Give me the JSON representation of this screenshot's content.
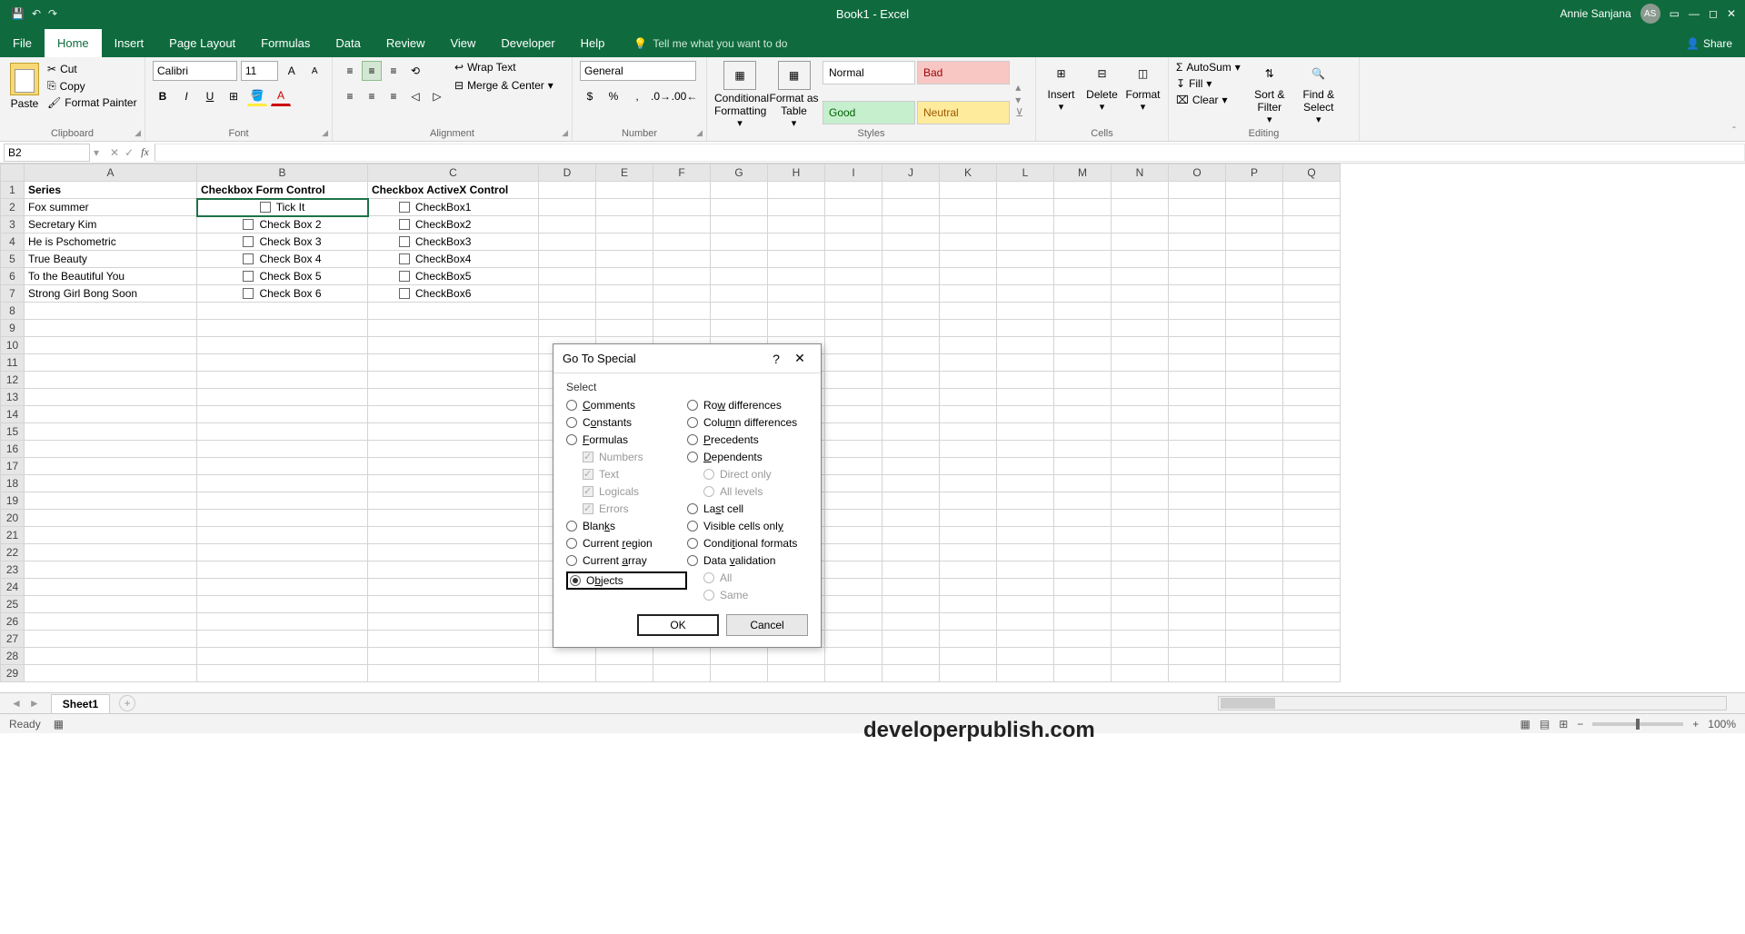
{
  "titlebar": {
    "title": "Book1 - Excel",
    "user": "Annie Sanjana",
    "initials": "AS"
  },
  "tabs": [
    "File",
    "Home",
    "Insert",
    "Page Layout",
    "Formulas",
    "Data",
    "Review",
    "View",
    "Developer",
    "Help"
  ],
  "tellme": "Tell me what you want to do",
  "share": "Share",
  "ribbon": {
    "clipboard": {
      "paste": "Paste",
      "cut": "Cut",
      "copy": "Copy",
      "painter": "Format Painter",
      "label": "Clipboard"
    },
    "font": {
      "name": "Calibri",
      "size": "11",
      "b": "B",
      "i": "I",
      "u": "U",
      "label": "Font"
    },
    "alignment": {
      "wrap": "Wrap Text",
      "merge": "Merge & Center",
      "label": "Alignment"
    },
    "number": {
      "format": "General",
      "label": "Number"
    },
    "styles": {
      "cond": "Conditional Formatting",
      "table": "Format as Table",
      "normal": "Normal",
      "bad": "Bad",
      "good": "Good",
      "neutral": "Neutral",
      "label": "Styles"
    },
    "cells": {
      "insert": "Insert",
      "delete": "Delete",
      "format": "Format",
      "label": "Cells"
    },
    "editing": {
      "sum": "AutoSum",
      "fill": "Fill",
      "clear": "Clear",
      "sort": "Sort & Filter",
      "find": "Find & Select",
      "label": "Editing"
    }
  },
  "namebox": "B2",
  "columns": [
    "A",
    "B",
    "C",
    "D",
    "E",
    "F",
    "G",
    "H",
    "I",
    "J",
    "K",
    "L",
    "M",
    "N",
    "O",
    "P",
    "Q"
  ],
  "headers": {
    "A": "Series",
    "B": "Checkbox Form Control",
    "C": "Checkbox ActiveX Control"
  },
  "series": [
    "Fox summer",
    "Secretary Kim",
    "He is Pschometric",
    "True Beauty",
    "To the Beautiful You",
    "Strong Girl Bong Soon"
  ],
  "formcontrols": [
    "Tick It",
    "Check Box 2",
    "Check Box 3",
    "Check Box 4",
    "Check Box 5",
    "Check Box 6"
  ],
  "activex": [
    "CheckBox1",
    "CheckBox2",
    "CheckBox3",
    "CheckBox4",
    "CheckBox5",
    "CheckBox6"
  ],
  "watermark": "developerpublish.com",
  "dialog": {
    "title": "Go To Special",
    "select": "Select",
    "comments": "Comments",
    "constants": "Constants",
    "formulas": "Formulas",
    "numbers": "Numbers",
    "text": "Text",
    "logicals": "Logicals",
    "errors": "Errors",
    "blanks": "Blanks",
    "region": "Current region",
    "array": "Current array",
    "objects": "Objects",
    "rowdiff": "Row differences",
    "coldiff": "Column differences",
    "prec": "Precedents",
    "dep": "Dependents",
    "direct": "Direct only",
    "all": "All levels",
    "last": "Last cell",
    "visible": "Visible cells only",
    "condf": "Conditional formats",
    "datav": "Data validation",
    "all2": "All",
    "same": "Same",
    "ok": "OK",
    "cancel": "Cancel"
  },
  "sheettab": "Sheet1",
  "status": {
    "ready": "Ready",
    "zoom": "100%"
  }
}
